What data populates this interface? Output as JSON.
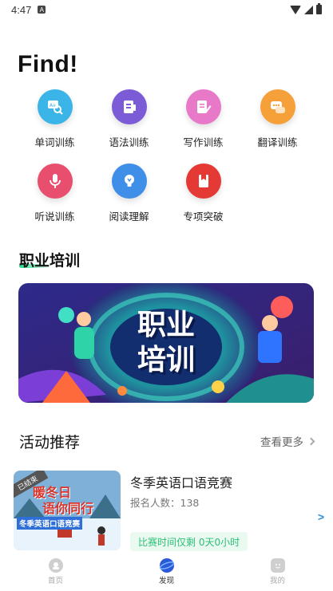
{
  "status": {
    "time": "4:47",
    "notification": "A"
  },
  "find": {
    "title": "Find!",
    "items": [
      {
        "label": "单词训练",
        "icon": "magnifier-word-icon",
        "color": "#3bb4e8"
      },
      {
        "label": "语法训练",
        "icon": "grammar-book-icon",
        "color": "#7b5cd6"
      },
      {
        "label": "写作训练",
        "icon": "pen-paper-icon",
        "color": "#e878c8"
      },
      {
        "label": "翻译训练",
        "icon": "chat-bubbles-icon",
        "color": "#f6a03a"
      },
      {
        "label": "听说训练",
        "icon": "microphone-icon",
        "color": "#e84f6e"
      },
      {
        "label": "阅读理解",
        "icon": "lightbulb-icon",
        "color": "#3f8fe8"
      },
      {
        "label": "专项突破",
        "icon": "book-icon",
        "color": "#e53935"
      }
    ]
  },
  "training": {
    "title": "职业培训",
    "banner_text_1": "职业",
    "banner_text_2": "培训"
  },
  "events": {
    "title": "活动推荐",
    "more_label": "查看更多",
    "card": {
      "badge": "已结束",
      "thumb_line_1": "暖冬日",
      "thumb_line_2": "语你同行",
      "thumb_subtitle": "冬季英语口语竞赛",
      "title": "冬季英语口语竞赛",
      "count_label": "报名人数：138",
      "time_label": "比赛时间仅剩 0天0小时",
      "arrow": ">"
    }
  },
  "nav": {
    "items": [
      {
        "label": "首页",
        "icon": "home-face-icon"
      },
      {
        "label": "发现",
        "icon": "planet-icon",
        "active": true
      },
      {
        "label": "我的",
        "icon": "smile-icon"
      }
    ]
  },
  "colors": {
    "accent": "#27d98a",
    "banner_bg": "#2b2b7a"
  }
}
